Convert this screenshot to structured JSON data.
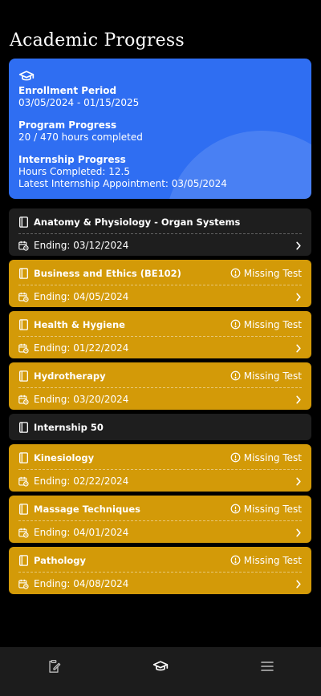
{
  "page": {
    "title": "Academic Progress"
  },
  "summary": {
    "enrollment_label": "Enrollment Period",
    "enrollment_value": "03/05/2024 - 01/15/2025",
    "program_label": "Program Progress",
    "program_value": "20 / 470 hours completed",
    "internship_label": "Internship Progress",
    "hours_value": "Hours Completed: 12.5",
    "appointment_value": "Latest Internship Appointment: 03/05/2024",
    "accent_color": "#2f6ef2"
  },
  "courses": [
    {
      "name": "Anatomy & Physiology - Organ Systems",
      "status": "",
      "ending": "Ending: 03/12/2024",
      "style": "dark"
    },
    {
      "name": "Business and Ethics (BE102)",
      "status": "Missing Test",
      "ending": "Ending: 04/05/2024",
      "style": "gold"
    },
    {
      "name": "Health & Hygiene",
      "status": "Missing Test",
      "ending": "Ending: 01/22/2024",
      "style": "gold"
    },
    {
      "name": "Hydrotherapy",
      "status": "Missing Test",
      "ending": "Ending: 03/20/2024",
      "style": "gold"
    },
    {
      "name": "Internship 50",
      "status": "",
      "ending": "",
      "style": "dark"
    },
    {
      "name": "Kinesiology",
      "status": "Missing Test",
      "ending": "Ending: 02/22/2024",
      "style": "gold"
    },
    {
      "name": "Massage Techniques",
      "status": "Missing Test",
      "ending": "Ending: 04/01/2024",
      "style": "gold"
    },
    {
      "name": "Pathology",
      "status": "Missing Test",
      "ending": "Ending: 04/08/2024",
      "style": "gold"
    }
  ],
  "colors": {
    "gold": "#d39a08",
    "dark_card": "#1e1e1e",
    "nav_bg": "#1c1c1c"
  },
  "nav": {
    "items": [
      {
        "icon": "clipboard-edit-icon"
      },
      {
        "icon": "graduation-cap-icon",
        "active": true
      },
      {
        "icon": "menu-icon"
      }
    ]
  }
}
